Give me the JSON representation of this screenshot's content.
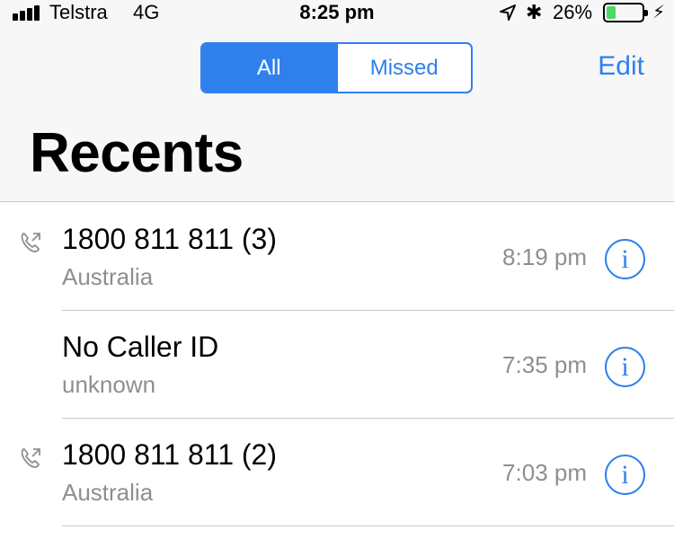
{
  "status_bar": {
    "carrier": "Telstra",
    "network": "4G",
    "time": "8:25 pm",
    "battery_percent": "26%",
    "battery_level": 0.26,
    "battery_color": "#4cd964"
  },
  "segmented": {
    "all_label": "All",
    "missed_label": "Missed",
    "selected": "All"
  },
  "edit_label": "Edit",
  "title": "Recents",
  "calls": [
    {
      "name": "1800 811 811 (3)",
      "subtitle": "Australia",
      "time": "8:19 pm",
      "icon": "outgoing-call-icon"
    },
    {
      "name": "No Caller ID",
      "subtitle": "unknown",
      "time": "7:35 pm",
      "icon": ""
    },
    {
      "name": "1800 811 811 (2)",
      "subtitle": "Australia",
      "time": "7:03 pm",
      "icon": "outgoing-call-icon"
    }
  ],
  "colors": {
    "accent": "#2f80ed",
    "secondary_text": "#8e8e93"
  }
}
